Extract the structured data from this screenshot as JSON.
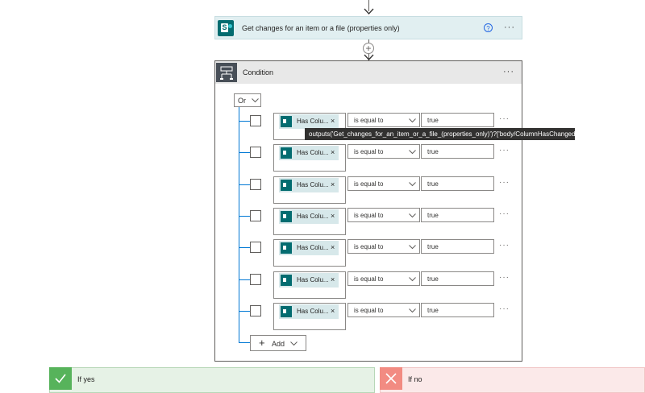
{
  "action": {
    "title": "Get changes for an item or a file (properties only)",
    "help_glyph": "?",
    "more": "···"
  },
  "plus_glyph": "+",
  "condition": {
    "title": "Condition",
    "more": "···",
    "group_operator": "Or",
    "rows": [
      {
        "token": "Has Colu...",
        "remove": "×",
        "operator": "is equal to",
        "value": "true",
        "more": "···"
      },
      {
        "token": "Has Colu...",
        "remove": "×",
        "operator": "is equal to",
        "value": "true",
        "more": "···"
      },
      {
        "token": "Has Colu...",
        "remove": "×",
        "operator": "is equal to",
        "value": "true",
        "more": "···"
      },
      {
        "token": "Has Colu...",
        "remove": "×",
        "operator": "is equal to",
        "value": "true",
        "more": "···"
      },
      {
        "token": "Has Colu...",
        "remove": "×",
        "operator": "is equal to",
        "value": "true",
        "more": "···"
      },
      {
        "token": "Has Colu...",
        "remove": "×",
        "operator": "is equal to",
        "value": "true",
        "more": "···"
      },
      {
        "token": "Has Colu...",
        "remove": "×",
        "operator": "is equal to",
        "value": "true",
        "more": "···"
      }
    ],
    "add_label": "Add",
    "add_glyph": "+",
    "tooltip": "outputs('Get_changes_for_an_item_or_a_file_(properties_only)')?['body/ColumnHasChanged/July']"
  },
  "branches": {
    "yes_label": "If yes",
    "no_label": "If no"
  },
  "colors": {
    "sharepoint": "#036c70",
    "accent": "#0078d4",
    "yes": "#57b35b",
    "no": "#f28b82"
  },
  "icons": {
    "action": "sharepoint-icon",
    "condition": "condition-icon",
    "yes": "checkmark-icon",
    "no": "close-icon"
  }
}
